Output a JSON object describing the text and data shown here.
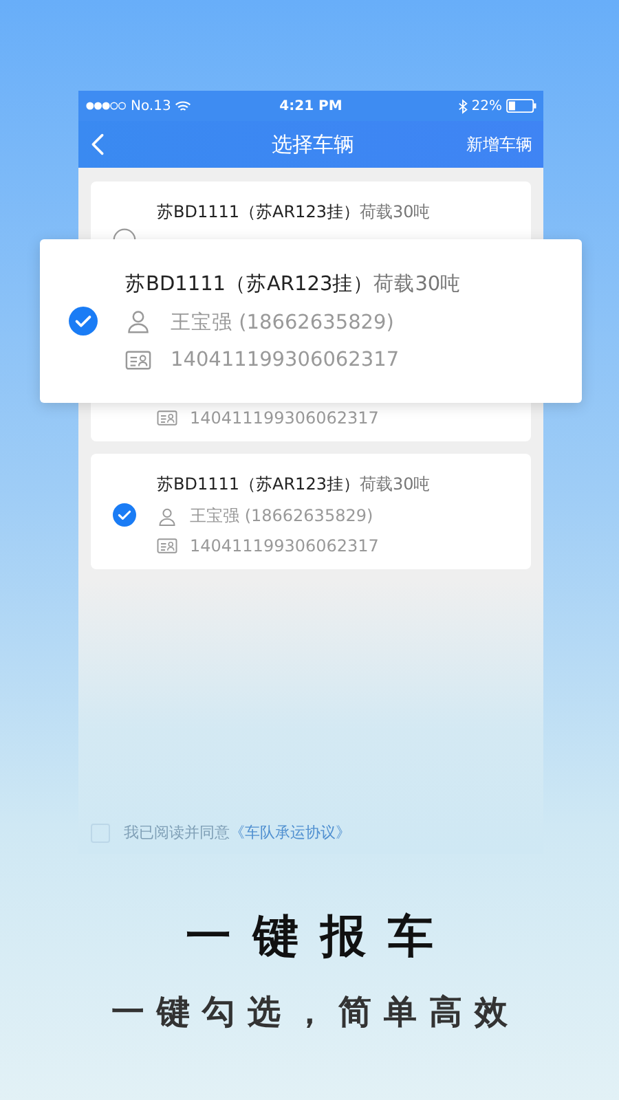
{
  "status_bar": {
    "carrier": "No.13",
    "time": "4:21 PM",
    "battery": "22%"
  },
  "nav_bar": {
    "title": "选择车辆",
    "action": "新增车辆"
  },
  "vehicles": [
    {
      "plate": "苏BD1111（苏AR123挂）",
      "load": "荷载30吨",
      "id_number": "140411199306062317",
      "selected": false
    },
    {
      "plate": "苏BD1111（苏AR123挂）",
      "load": "荷载30吨",
      "driver": "王宝强 (18662635829)",
      "id_number": "140411199306062317",
      "selected": true
    }
  ],
  "popup_card": {
    "plate": "苏BD1111（苏AR123挂）",
    "load": "荷载30吨",
    "driver": "王宝强 (18662635829)",
    "id_number": "140411199306062317",
    "selected": true
  },
  "agreement": {
    "checked": false,
    "text": "我已阅读并同意",
    "link": "《车队承运协议》"
  },
  "headline": "一键报车",
  "subheadline": "一键勾选，简单高效"
}
